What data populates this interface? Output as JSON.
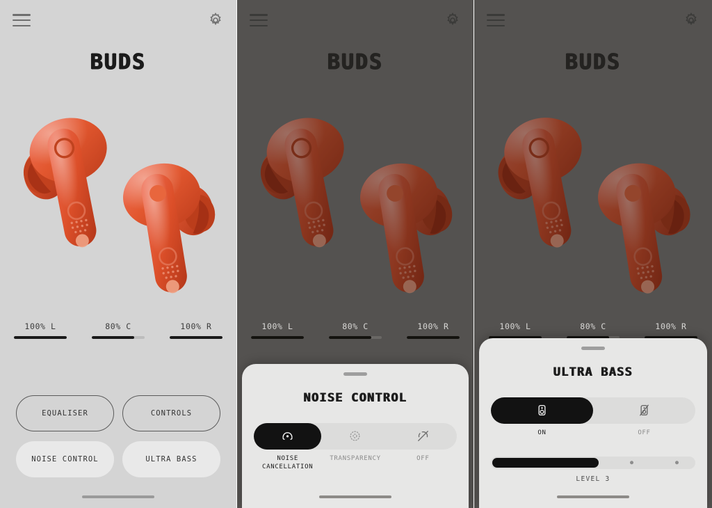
{
  "app": {
    "title": "BUDS",
    "menu_icon": "hamburger-menu-icon",
    "settings_icon": "gear-icon",
    "accent_color": "#DD4F29",
    "bg_color": "#D4D4D4",
    "dim_overlay_color": "#545250"
  },
  "battery": [
    {
      "label": "100% L",
      "percent": 100
    },
    {
      "label": "80% C",
      "percent": 80
    },
    {
      "label": "100% R",
      "percent": 100
    }
  ],
  "actions": [
    {
      "label": "EQUALISER",
      "style": "outline"
    },
    {
      "label": "CONTROLS",
      "style": "outline"
    },
    {
      "label": "NOISE CONTROL",
      "style": "filled"
    },
    {
      "label": "ULTRA BASS",
      "style": "filled"
    }
  ],
  "noise_sheet": {
    "title": "NOISE CONTROL",
    "options": [
      {
        "label": "NOISE\nCANCELLATION",
        "icon": "noise-cancellation-icon",
        "selected": true
      },
      {
        "label": "TRANSPARENCY",
        "icon": "transparency-icon",
        "selected": false
      },
      {
        "label": "OFF",
        "icon": "noise-off-icon",
        "selected": false
      }
    ]
  },
  "bass_sheet": {
    "title": "ULTRA BASS",
    "toggle": [
      {
        "label": "ON",
        "icon": "speaker-icon",
        "selected": true
      },
      {
        "label": "OFF",
        "icon": "speaker-muted-icon",
        "selected": false
      }
    ],
    "level_label": "LEVEL 3",
    "level_value": 3,
    "level_max": 5,
    "level_percent": 52
  },
  "panels": [
    {
      "name": "home",
      "sheet": "none"
    },
    {
      "name": "noise-control",
      "sheet": "noise_sheet"
    },
    {
      "name": "ultra-bass",
      "sheet": "bass_sheet"
    }
  ]
}
